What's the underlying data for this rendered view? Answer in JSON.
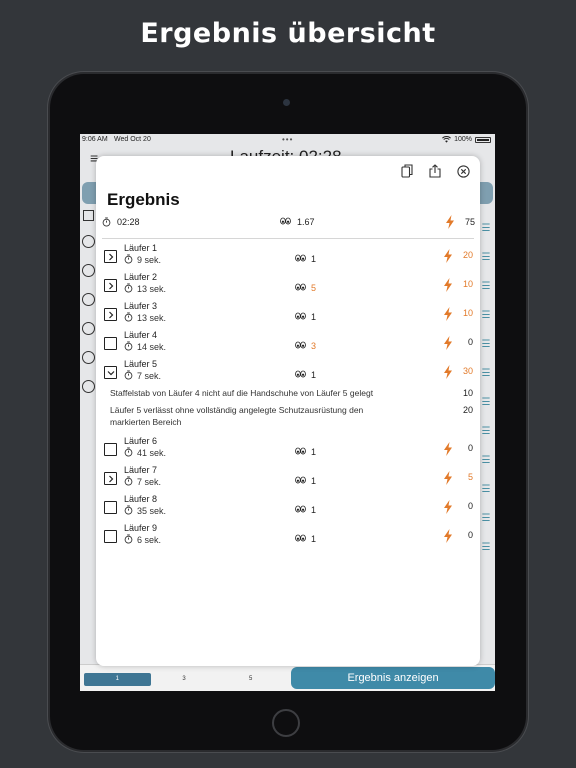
{
  "promo": {
    "title": "Ergebnis übersicht"
  },
  "statusbar": {
    "time": "9:06 AM",
    "date": "Wed Oct 20",
    "battery": "100%"
  },
  "background": {
    "nav_title": "Laufzeit: 02:28",
    "segments": [
      "1",
      "3",
      "5"
    ],
    "result_button": "Ergebnis anzeigen"
  },
  "modal": {
    "title": "Ergebnis",
    "summary": {
      "time": "02:28",
      "eyes": "1.67",
      "points": "75"
    },
    "runners": [
      {
        "name": "Läufer 1",
        "time": "9 sek.",
        "eyes": "1",
        "eyes_orange": false,
        "points": "20",
        "points_orange": true,
        "checkbox": "chevron"
      },
      {
        "name": "Läufer 2",
        "time": "13 sek.",
        "eyes": "5",
        "eyes_orange": true,
        "points": "10",
        "points_orange": true,
        "checkbox": "chevron"
      },
      {
        "name": "Läufer 3",
        "time": "13 sek.",
        "eyes": "1",
        "eyes_orange": false,
        "points": "10",
        "points_orange": true,
        "checkbox": "chevron"
      },
      {
        "name": "Läufer 4",
        "time": "14 sek.",
        "eyes": "3",
        "eyes_orange": true,
        "points": "0",
        "points_orange": false,
        "checkbox": "empty"
      },
      {
        "name": "Läufer 5",
        "time": "7 sek.",
        "eyes": "1",
        "eyes_orange": false,
        "points": "30",
        "points_orange": true,
        "checkbox": "expanded"
      },
      {
        "name": "Läufer 6",
        "time": "41 sek.",
        "eyes": "1",
        "eyes_orange": false,
        "points": "0",
        "points_orange": false,
        "checkbox": "empty"
      },
      {
        "name": "Läufer 7",
        "time": "7 sek.",
        "eyes": "1",
        "eyes_orange": false,
        "points": "5",
        "points_orange": true,
        "checkbox": "chevron"
      },
      {
        "name": "Läufer 8",
        "time": "35 sek.",
        "eyes": "1",
        "eyes_orange": false,
        "points": "0",
        "points_orange": false,
        "checkbox": "empty"
      },
      {
        "name": "Läufer 9",
        "time": "6 sek.",
        "eyes": "1",
        "eyes_orange": false,
        "points": "0",
        "points_orange": false,
        "checkbox": "empty"
      }
    ],
    "penalties": [
      {
        "text": "Staffelstab von Läufer 4 nicht auf die Handschuhe von Läufer 5 gelegt",
        "points": "10"
      },
      {
        "text": "Läufer 5 verlässt ohne vollständig angelegte Schutzausrüstung den markierten Bereich",
        "points": "20"
      }
    ]
  },
  "colors": {
    "accent": "#e27a2a",
    "blue": "#3f8aa8"
  },
  "icons": {
    "copy": "copy-icon",
    "share": "share-icon",
    "close": "close-icon",
    "timer": "stopwatch-icon",
    "eyes": "eyes-icon",
    "bolt": "lightning-icon"
  }
}
